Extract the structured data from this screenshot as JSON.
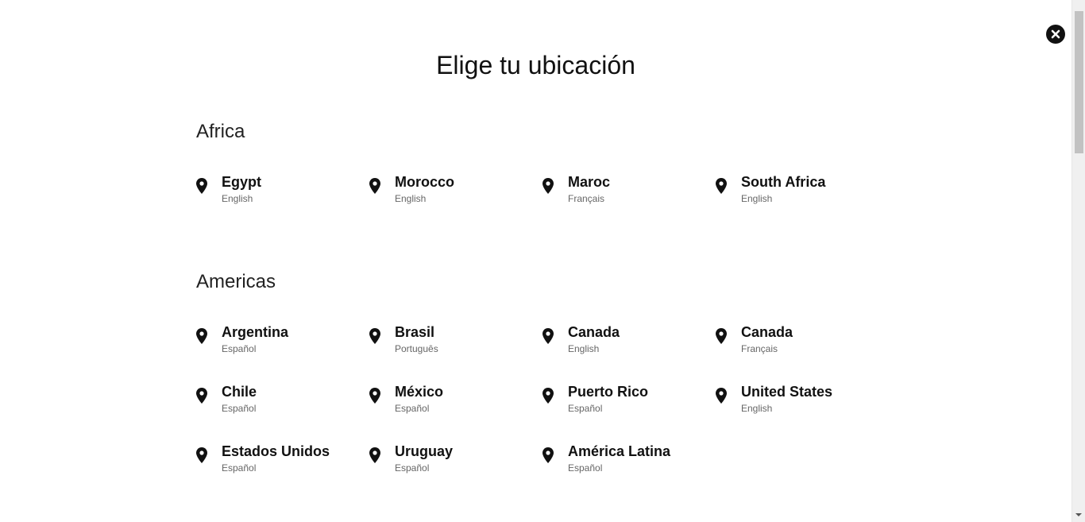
{
  "page_title": "Elige tu ubicación",
  "close_icon": "close-icon",
  "regions": [
    {
      "title": "Africa",
      "locations": [
        {
          "country": "Egypt",
          "language": "English"
        },
        {
          "country": "Morocco",
          "language": "English"
        },
        {
          "country": "Maroc",
          "language": "Français"
        },
        {
          "country": "South Africa",
          "language": "English"
        }
      ]
    },
    {
      "title": "Americas",
      "locations": [
        {
          "country": "Argentina",
          "language": "Español"
        },
        {
          "country": "Brasil",
          "language": "Português"
        },
        {
          "country": "Canada",
          "language": "English"
        },
        {
          "country": "Canada",
          "language": "Français"
        },
        {
          "country": "Chile",
          "language": "Español"
        },
        {
          "country": "México",
          "language": "Español"
        },
        {
          "country": "Puerto Rico",
          "language": "Español"
        },
        {
          "country": "United States",
          "language": "English"
        },
        {
          "country": "Estados Unidos",
          "language": "Español"
        },
        {
          "country": "Uruguay",
          "language": "Español"
        },
        {
          "country": "América Latina",
          "language": "Español"
        }
      ]
    }
  ],
  "colors": {
    "text": "#111111",
    "subtext": "#666666",
    "background": "#ffffff"
  }
}
